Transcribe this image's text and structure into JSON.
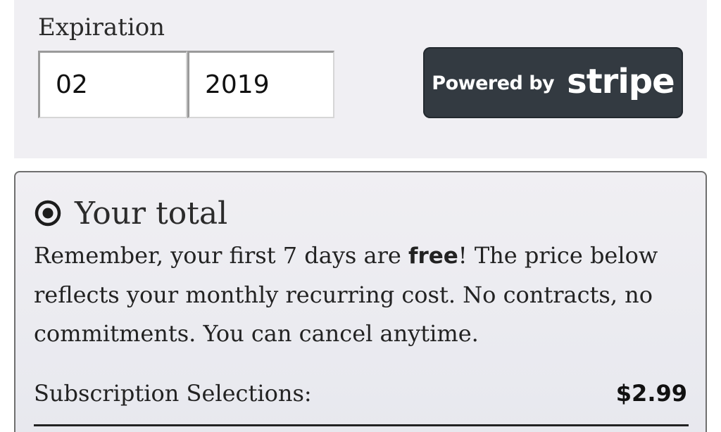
{
  "payment": {
    "expiration_label": "Expiration",
    "month_value": "02",
    "year_value": "2019",
    "powered_by": "Powered by",
    "stripe": "stripe"
  },
  "total": {
    "title": "Your total",
    "desc_before": "Remember, your first 7 days are ",
    "desc_bold": "free",
    "desc_after": "! The price below reflects your monthly recurring cost. No contracts, no commitments. You can cancel anytime.",
    "subscription_label": "Subscription Selections:",
    "subscription_price": "$2.99"
  },
  "colors": {
    "panel_background": "#f0eff3",
    "stripe_badge": "#333a41",
    "card_border": "#6f6f6f"
  },
  "icons": {
    "total_marker": "radio-selected-icon"
  }
}
